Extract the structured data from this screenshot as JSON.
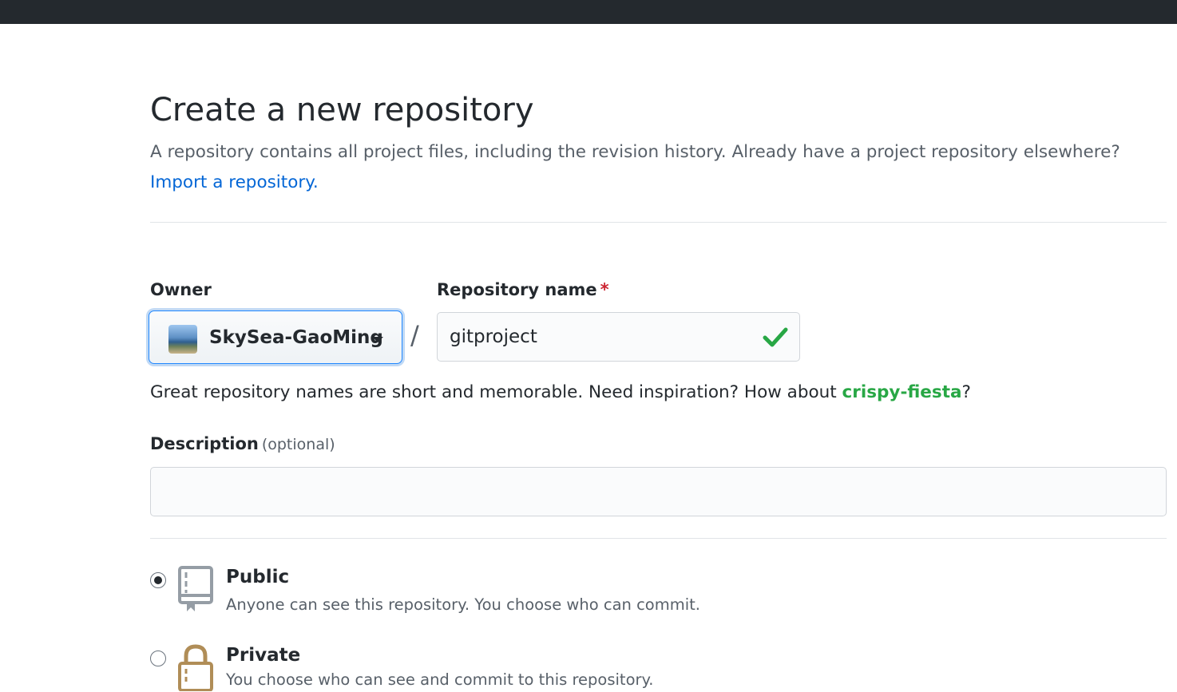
{
  "header": {
    "title": "Create a new repository",
    "subhead_text": "A repository contains all project files, including the revision history. Already have a project repository elsewhere?",
    "import_link": "Import a repository."
  },
  "owner": {
    "label": "Owner",
    "selected": "SkySea-GaoMing",
    "avatar_icon": "user-avatar"
  },
  "separator": "/",
  "repository": {
    "label": "Repository name",
    "required_marker": "*",
    "value": "gitproject",
    "status_icon": "check-icon",
    "status_color": "#28a745"
  },
  "hint": {
    "prefix": "Great repository names are short and memorable. Need inspiration? How about ",
    "suggestion": "crispy-fiesta",
    "suffix": "?"
  },
  "description": {
    "label": "Description",
    "optional": "(optional)",
    "value": "",
    "placeholder": ""
  },
  "visibility": {
    "options": [
      {
        "title": "Public",
        "description": "Anyone can see this repository. You choose who can commit.",
        "icon": "repo-icon",
        "checked": true
      },
      {
        "title": "Private",
        "description": "You choose who can see and commit to this repository.",
        "icon": "lock-icon",
        "checked": false
      }
    ]
  },
  "colors": {
    "topbar": "#24292e",
    "link": "#0366d6",
    "suggestion": "#28a745",
    "required": "#cb2431",
    "lock_icon": "#b08d57"
  }
}
